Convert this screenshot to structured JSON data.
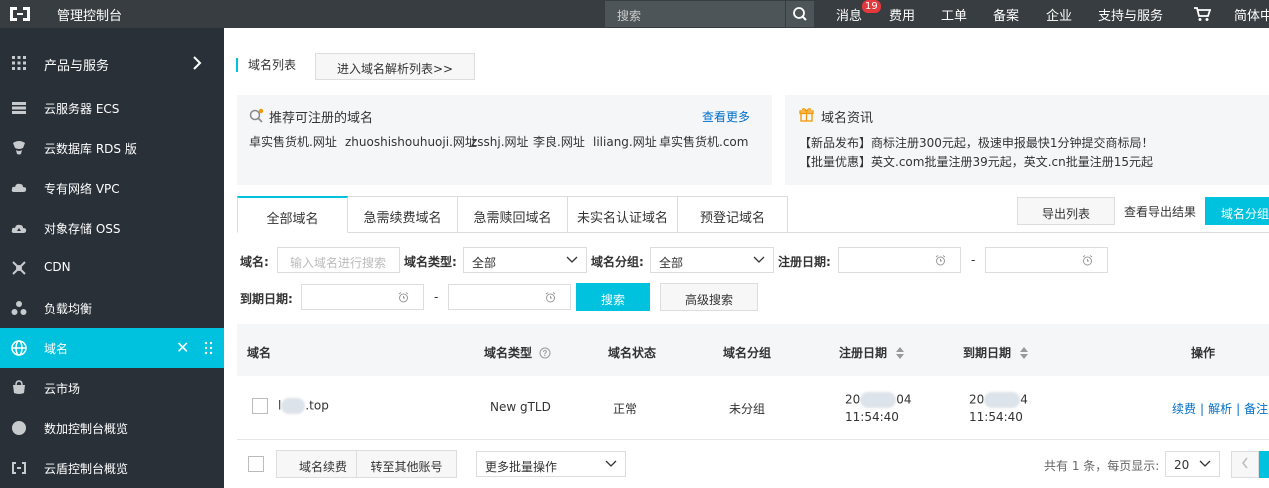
{
  "topbar": {
    "title": "管理控制台",
    "search_placeholder": "搜索",
    "nav": {
      "messages": "消息",
      "messages_badge": "19",
      "billing": "费用",
      "tickets": "工单",
      "filing": "备案",
      "enterprise": "企业",
      "support": "支持与服务",
      "language": "简体中"
    }
  },
  "sidebar": {
    "products": "产品与服务",
    "items": [
      {
        "label": "云服务器 ECS",
        "icon": "server-icon"
      },
      {
        "label": "云数据库 RDS 版",
        "icon": "database-icon"
      },
      {
        "label": "专有网络 VPC",
        "icon": "cloud-network-icon"
      },
      {
        "label": "对象存储 OSS",
        "icon": "cloud-storage-icon"
      },
      {
        "label": "CDN",
        "icon": "cdn-icon"
      },
      {
        "label": "负载均衡",
        "icon": "load-balancer-icon"
      },
      {
        "label": "域名",
        "icon": "globe-icon"
      },
      {
        "label": "云市场",
        "icon": "market-icon"
      },
      {
        "label": "数加控制台概览",
        "icon": "circle-icon"
      },
      {
        "label": "云盾控制台概览",
        "icon": "shield-icon"
      }
    ]
  },
  "main": {
    "breadcrumb": "域名列表",
    "dns_button": "进入域名解析列表>>",
    "recommend": {
      "title": "推荐可注册的域名",
      "more": "查看更多",
      "links": [
        "卓实售货机.网址",
        "zhuoshishouhuoji.网址",
        "zsshj.网址",
        "李良.网址",
        "liliang.网址",
        "卓实售货机.com"
      ]
    },
    "news": {
      "title": "域名资讯",
      "lines": [
        "【新品发布】商标注册300元起，极速申报最快1分钟提交商标局！",
        "【批量优惠】英文.com批量注册39元起，英文.cn批量注册15元起"
      ]
    },
    "tabs": [
      "全部域名",
      "急需续费域名",
      "急需赎回域名",
      "未实名认证域名",
      "预登记域名"
    ],
    "export_button": "导出列表",
    "export_results": "查看导出结果",
    "group_button": "域名分组",
    "filters": {
      "domain_label": "域名:",
      "domain_placeholder": "输入域名进行搜索",
      "type_label": "域名类型:",
      "type_value": "全部",
      "group_label": "域名分组:",
      "group_value": "全部",
      "reg_label": "注册日期:",
      "exp_label": "到期日期:",
      "dash": "-",
      "search": "搜索",
      "advanced": "高级搜索"
    },
    "table": {
      "headers": [
        "域名",
        "域名类型",
        "域名状态",
        "域名分组",
        "注册日期",
        "到期日期",
        "操作"
      ],
      "row": {
        "domain_prefix": "l",
        "domain_suffix": ".top",
        "type": "New gTLD",
        "status": "正常",
        "group": "未分组",
        "reg_date_a": "20",
        "reg_date_b": "04",
        "reg_time": "11:54:40",
        "exp_date_a": "20",
        "exp_date_b": "4",
        "exp_time": "11:54:40",
        "actions": [
          "续费",
          "解析",
          "备注"
        ]
      }
    },
    "footer": {
      "renew": "域名续费",
      "transfer": "转至其他账号",
      "batch": "更多批量操作",
      "summary": "共有 1 条，每页显示:",
      "page_size": "20"
    }
  }
}
